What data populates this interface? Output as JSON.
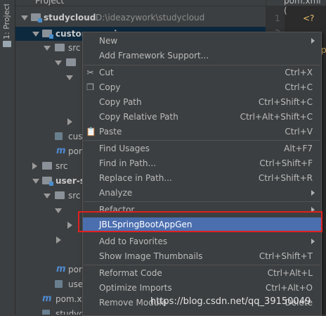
{
  "tool_strip": {
    "label": "1: Project"
  },
  "project_panel": {
    "title": "Project",
    "tree": [
      {
        "type": "module",
        "name": "studycloud",
        "path": "D:\\ideazywork\\studycloud"
      },
      {
        "type": "module",
        "name": "custom-service"
      },
      {
        "type": "folder",
        "name": "src"
      },
      {
        "type": "file",
        "name": "cus"
      },
      {
        "type": "pom",
        "name": "pom"
      },
      {
        "type": "folder",
        "name": "src"
      },
      {
        "type": "module",
        "name": "user-s"
      },
      {
        "type": "folder",
        "name": "src"
      },
      {
        "type": "pom",
        "name": "pom"
      },
      {
        "type": "file",
        "name": "use"
      },
      {
        "type": "pom",
        "name": "pom.x"
      },
      {
        "type": "file",
        "name": "studycl"
      }
    ]
  },
  "editor": {
    "tab": "pom.xml (",
    "line_numbers": [
      "1",
      "2"
    ],
    "code": [
      "<?",
      "p"
    ]
  },
  "context_menu": {
    "items": [
      {
        "label": "New",
        "shortcut": "",
        "submenu": true
      },
      {
        "label": "Add Framework Support...",
        "shortcut": ""
      },
      {
        "label": "Cut",
        "shortcut": "Ctrl+X",
        "icon": "cut-icon"
      },
      {
        "label": "Copy",
        "shortcut": "Ctrl+C",
        "icon": "copy-icon"
      },
      {
        "label": "Copy Path",
        "shortcut": "Ctrl+Shift+C"
      },
      {
        "label": "Copy Relative Path",
        "shortcut": "Ctrl+Alt+Shift+C"
      },
      {
        "label": "Paste",
        "shortcut": "Ctrl+V",
        "icon": "paste-icon"
      },
      {
        "label": "Find Usages",
        "shortcut": "Alt+F7"
      },
      {
        "label": "Find in Path...",
        "shortcut": "Ctrl+Shift+F"
      },
      {
        "label": "Replace in Path...",
        "shortcut": "Ctrl+Shift+R"
      },
      {
        "label": "Analyze",
        "shortcut": "",
        "submenu": true
      },
      {
        "label": "Refactor",
        "shortcut": "",
        "submenu": true
      },
      {
        "label": "JBLSpringBootAppGen",
        "shortcut": "",
        "highlighted": true
      },
      {
        "label": "Add to Favorites",
        "shortcut": "",
        "submenu": true
      },
      {
        "label": "Show Image Thumbnails",
        "shortcut": "Ctrl+Shift+T"
      },
      {
        "label": "Reformat Code",
        "shortcut": "Ctrl+Alt+L"
      },
      {
        "label": "Optimize Imports",
        "shortcut": "Ctrl+Alt+O"
      },
      {
        "label": "Remove Module",
        "shortcut": "Delete"
      }
    ]
  },
  "colors": {
    "menu_highlight": "#4b6eaf",
    "annotation_box": "#e02020",
    "maven_file": "#4f8ad3"
  },
  "watermark": "https://blog.csdn.net/qq_39150049"
}
